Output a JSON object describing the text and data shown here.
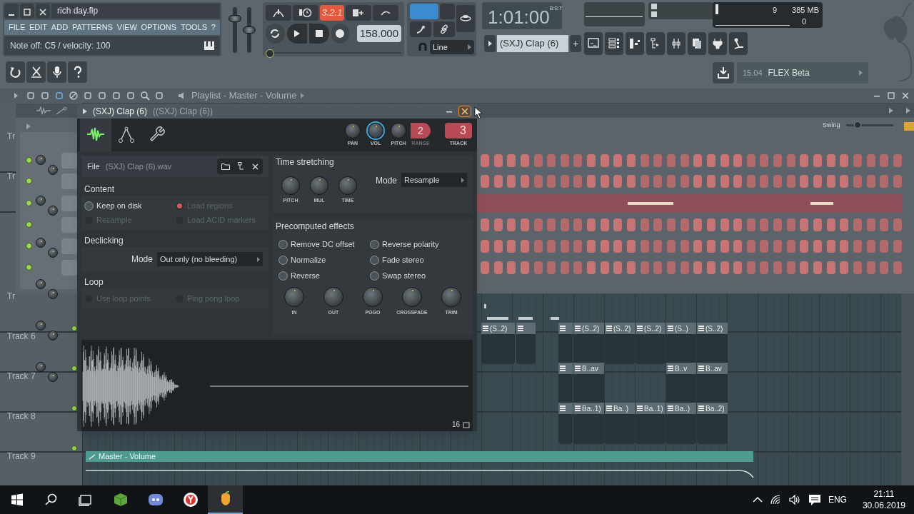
{
  "main_menu": {
    "file_name": "rich day.flp",
    "items": [
      "FILE",
      "EDIT",
      "ADD",
      "PATTERNS",
      "VIEW",
      "OPTIONS",
      "TOOLS",
      "?"
    ],
    "hint": "Note off: C5 / velocity: 100"
  },
  "transport": {
    "pattern_display": "3.2.1",
    "tempo": "158.000",
    "snap": "Line",
    "time": "1:01:00",
    "time_label": "B:S:T",
    "pattern": "(SXJ) Clap (6)",
    "add_button": "+",
    "master_volume": {
      "level": 0.8
    },
    "master_pitch": {
      "level": 0.5
    },
    "song_position": {
      "level": 0
    }
  },
  "monitor": {
    "cpu": "9",
    "memory": "385 MB",
    "polyphony": "0"
  },
  "news": {
    "version": "15.04",
    "title": "FLEX Beta"
  },
  "playlist": {
    "title": "Playlist - Master - Volume",
    "tracks": [
      {
        "name": "Tr"
      },
      {
        "name": "Tr"
      },
      {
        "name": "Tr"
      },
      {
        "name": "Track 6",
        "clips": [
          {
            "kind": "pattern",
            "label": "(S..2)"
          },
          {
            "kind": "pattern"
          },
          {
            "kind": "pattern"
          },
          {
            "kind": "pattern",
            "label": "(S..2)"
          },
          {
            "kind": "pattern",
            "label": "(S..2)"
          },
          {
            "kind": "pattern",
            "label": "(S..2)"
          },
          {
            "kind": "pattern",
            "label": "(S..)"
          },
          {
            "kind": "pattern",
            "label": "(S..2)"
          }
        ]
      },
      {
        "name": "Track 7",
        "clips": [
          {
            "kind": "pattern"
          },
          {
            "kind": "pattern",
            "label": "B..av"
          },
          {
            "kind": "pattern",
            "label": "B..v"
          },
          {
            "kind": "pattern",
            "label": "B..av"
          }
        ]
      },
      {
        "name": "Track 8",
        "clips": [
          {
            "kind": "pattern"
          },
          {
            "kind": "pattern",
            "label": "Ba..1)"
          },
          {
            "kind": "pattern",
            "label": "Ba..)"
          },
          {
            "kind": "pattern",
            "label": "Ba..1)"
          },
          {
            "kind": "pattern",
            "label": "Ba..)"
          },
          {
            "kind": "pattern",
            "label": "Ba..2)"
          }
        ]
      },
      {
        "name": "Track 9",
        "automation": "Master - Volume"
      }
    ]
  },
  "channel_rack": {
    "swing": {
      "label": "Swing",
      "level": 0.2
    },
    "channels": [
      {
        "kind": "steps"
      },
      {
        "kind": "steps"
      },
      {
        "kind": "piano_roll"
      },
      {
        "kind": "steps"
      },
      {
        "kind": "steps"
      },
      {
        "kind": "steps"
      }
    ]
  },
  "sampler": {
    "title": "(SXJ) Clap (6)",
    "subtitle": "((SXJ) Clap (6))",
    "tabs": [
      {
        "kind": "wave",
        "selected": true
      },
      {
        "kind": "envelope",
        "selected": false
      },
      {
        "kind": "wrench",
        "selected": false
      }
    ],
    "knobs": [
      {
        "label": "PAN"
      },
      {
        "label": "VOL"
      },
      {
        "label": "PITCH"
      }
    ],
    "range": {
      "value": "2",
      "label": "RANGE"
    },
    "track": {
      "value": "3",
      "label": "TRACK"
    },
    "file": {
      "label": "File",
      "name": "(SXJ) Clap (6).wav"
    },
    "content": {
      "title": "Content",
      "options": [
        {
          "label": "Keep on disk",
          "checked": false,
          "disabled": false
        },
        {
          "label": "Load regions",
          "checked": true,
          "disabled": true
        },
        {
          "label": "Resample",
          "checked": false,
          "disabled": true
        },
        {
          "label": "Load ACID markers",
          "checked": false,
          "disabled": true
        }
      ]
    },
    "declicking": {
      "title": "Declicking",
      "mode_label": "Mode",
      "mode": "Out only (no bleeding)"
    },
    "loop": {
      "title": "Loop",
      "options": [
        {
          "label": "Use loop points",
          "checked": false,
          "disabled": true
        },
        {
          "label": "Ping pong loop",
          "checked": false,
          "disabled": true
        }
      ]
    },
    "time_stretching": {
      "title": "Time stretching",
      "knobs": [
        "PITCH",
        "MUL",
        "TIME"
      ],
      "mode_label": "Mode",
      "mode": "Resample"
    },
    "effects": {
      "title": "Precomputed effects",
      "options": [
        {
          "label": "Remove DC offset",
          "checked": false
        },
        {
          "label": "Reverse polarity",
          "checked": false
        },
        {
          "label": "Normalize",
          "checked": false
        },
        {
          "label": "Fade stereo",
          "checked": false
        },
        {
          "label": "Reverse",
          "checked": false
        },
        {
          "label": "Swap stereo",
          "checked": false
        }
      ],
      "knobs": [
        "IN",
        "OUT",
        "POGO",
        "CROSSFADE",
        "TRIM"
      ]
    },
    "waveform": {
      "zoom": "16"
    }
  },
  "taskbar": {
    "language": "ENG",
    "time": "21:11",
    "date": "30.06.2019"
  }
}
